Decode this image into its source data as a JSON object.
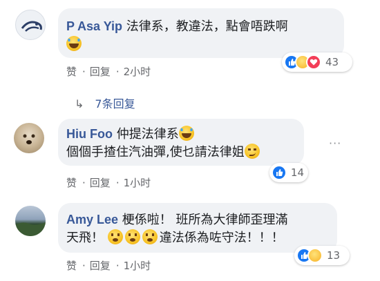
{
  "comments": [
    {
      "author": "P Asa Yip",
      "lines": [
        "法律系，教違法，點會唔跌啊",
        ""
      ],
      "like_label": "赞",
      "reply_label": "回复",
      "time": "2小时",
      "reaction_count": "43",
      "reactions": [
        "like-icon",
        "haha-icon",
        "love-icon"
      ],
      "avatar_colors": [
        "#e9edf2",
        "#2c3e66"
      ]
    },
    {
      "author": "Hiu Foo",
      "lines": [
        "仲提法律系",
        "個個手揸住汽油彈,使乜請法律姐"
      ],
      "like_label": "赞",
      "reply_label": "回复",
      "time": "1小时",
      "reaction_count": "14",
      "reactions": [
        "like-icon"
      ]
    },
    {
      "author": "Amy Lee",
      "lines": [
        "梗係啦！ 班所為大律師歪理滿",
        "違法係為咗守法！！！"
      ],
      "line2_prefix": "天飛！",
      "like_label": "赞",
      "reply_label": "回复",
      "time": "1小时",
      "reaction_count": "13",
      "reactions": [
        "like-icon",
        "haha-icon"
      ]
    }
  ],
  "replies_link": "7条回复",
  "more_label": "···",
  "colors": {
    "name": "#385898",
    "bubble": "#f0f2f5",
    "meta": "#65676b",
    "like": "#1877f2"
  }
}
